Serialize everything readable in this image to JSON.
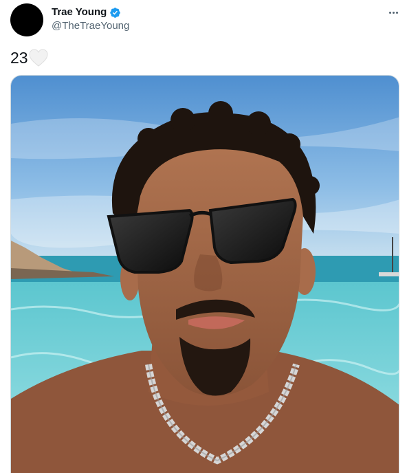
{
  "user": {
    "display_name": "Trae Young",
    "handle": "@TheTraeYoung",
    "verified": true,
    "verified_icon": "verified-badge-icon",
    "verified_color": "#1d9bf0"
  },
  "tweet": {
    "text": "23",
    "emoji_icon": "white-heart-icon"
  },
  "media": {
    "type": "photo",
    "icon": "photo-selfie-icon"
  },
  "menu": {
    "icon": "more-options-icon"
  },
  "colors": {
    "text": "#0f1419",
    "secondary_text": "#536471",
    "border": "#cfd9de",
    "sky": "#6fa8d8",
    "water": "#7fd3d9"
  }
}
